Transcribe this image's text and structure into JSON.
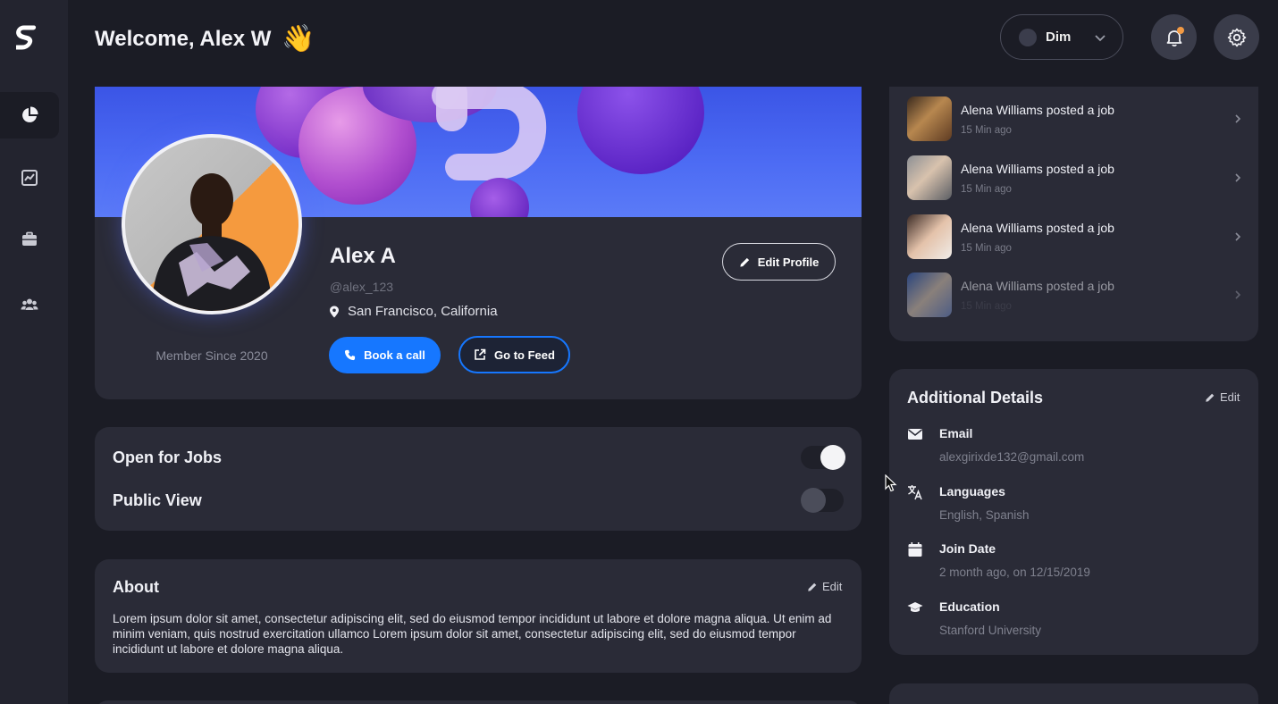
{
  "header": {
    "welcome": "Welcome, Alex W",
    "wave_emoji": "👋",
    "theme": {
      "label": "Dim"
    }
  },
  "sidebar": {
    "logo_letter": "S",
    "items": [
      {
        "id": "dashboard",
        "icon": "pie-chart-icon",
        "active": true
      },
      {
        "id": "analytics",
        "icon": "line-chart-icon",
        "active": false
      },
      {
        "id": "jobs",
        "icon": "briefcase-icon",
        "active": false
      },
      {
        "id": "community",
        "icon": "people-icon",
        "active": false
      }
    ]
  },
  "profile": {
    "name": "Alex A",
    "handle": "@alex_123",
    "location": "San Francisco, California",
    "member_since": "Member Since 2020",
    "edit_label": "Edit Profile",
    "book_call_label": "Book a call",
    "go_to_feed_label": "Go to Feed"
  },
  "toggles": [
    {
      "label": "Open for Jobs",
      "on": true
    },
    {
      "label": "Public View",
      "on": false
    }
  ],
  "about": {
    "title": "About",
    "edit_label": "Edit",
    "text": "Lorem ipsum dolor sit amet, consectetur adipiscing elit, sed do eiusmod tempor incididunt ut labore et dolore magna aliqua. Ut enim ad minim veniam, quis nostrud exercitation ullamco Lorem ipsum dolor sit amet, consectetur adipiscing elit, sed do eiusmod tempor incididunt ut labore et dolore magna aliqua."
  },
  "activity": [
    {
      "title": "Alena Williams posted a job",
      "time": "15 Min ago"
    },
    {
      "title": "Alena Williams posted a job",
      "time": "15 Min ago"
    },
    {
      "title": "Alena Williams posted a job",
      "time": "15 Min ago"
    },
    {
      "title": "Alena Williams posted a job",
      "time": "15 Min ago"
    }
  ],
  "details": {
    "title": "Additional Details",
    "edit_label": "Edit",
    "rows": [
      {
        "label": "Email",
        "value": "alexgirixde132@gmail.com",
        "icon": "mail-icon"
      },
      {
        "label": "Languages",
        "value": "English, Spanish",
        "icon": "translate-icon"
      },
      {
        "label": "Join Date",
        "value": "2 month ago, on 12/15/2019",
        "icon": "calendar-icon"
      },
      {
        "label": "Education",
        "value": "Stanford University",
        "icon": "graduation-cap-icon"
      }
    ]
  },
  "colors": {
    "background": "#1b1c25",
    "card": "#2a2b37",
    "accent": "#1677ff",
    "notification": "#f29a44"
  }
}
